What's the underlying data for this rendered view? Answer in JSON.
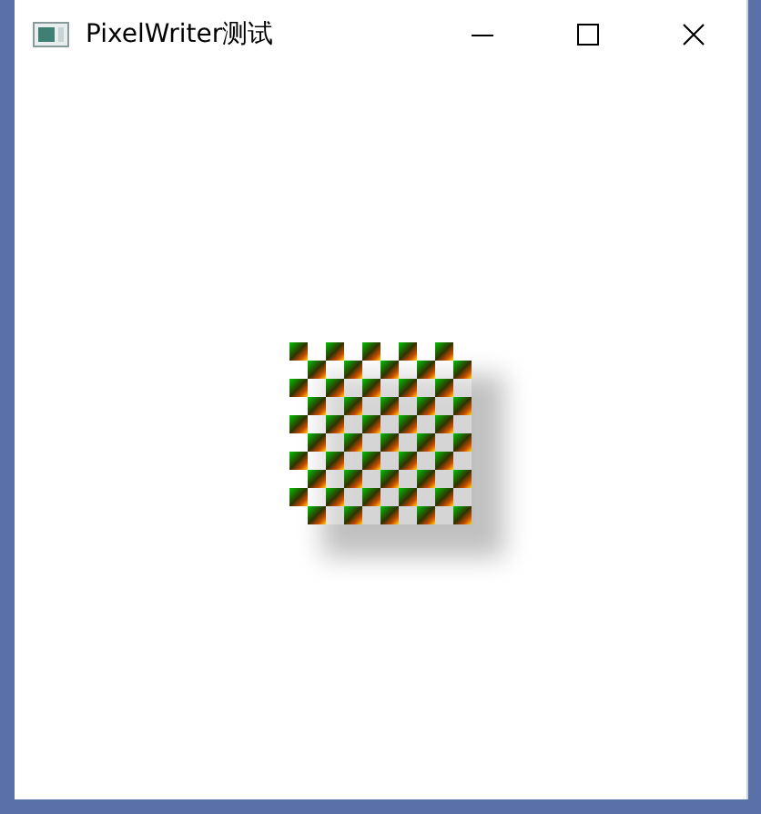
{
  "window": {
    "title": "PixelWriter测试",
    "controls": [
      {
        "kind": "minimize"
      },
      {
        "kind": "maximize"
      },
      {
        "kind": "close"
      }
    ]
  },
  "canvas": {
    "kind": "checkerboard"
  }
}
